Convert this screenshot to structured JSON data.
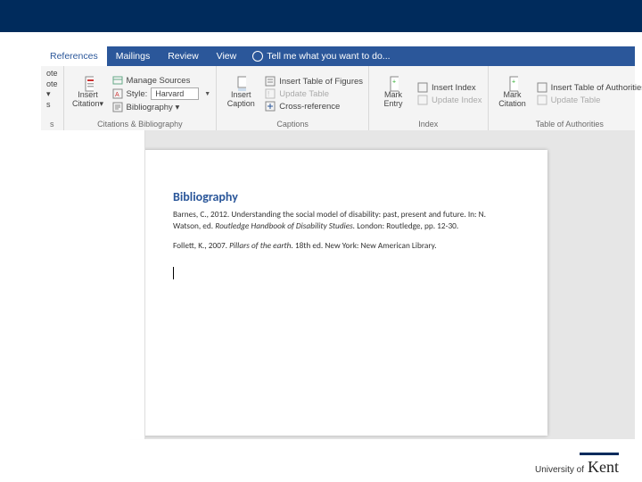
{
  "topbar": {},
  "tabs": {
    "active": "References",
    "items": [
      "References",
      "Mailings",
      "Review",
      "View"
    ],
    "tell_me": "Tell me what you want to do..."
  },
  "ribbon": {
    "frag": {
      "l1": "ote",
      "l2": "ote ▾",
      "l3": "s",
      "group": "s"
    },
    "citations": {
      "big_label": "Insert\nCitation▾",
      "manage": "Manage Sources",
      "style_label": "Style:",
      "style_value": "Harvard",
      "biblio": "Bibliography ▾",
      "group": "Citations & Bibliography"
    },
    "captions": {
      "big_label": "Insert\nCaption",
      "tof": "Insert Table of Figures",
      "update": "Update Table",
      "cross": "Cross-reference",
      "group": "Captions"
    },
    "index": {
      "big_label": "Mark\nEntry",
      "insert": "Insert Index",
      "update": "Update Index",
      "group": "Index"
    },
    "toa": {
      "big_label": "Mark\nCitation",
      "insert": "Insert Table of Authorities",
      "update": "Update Table",
      "group": "Table of Authorities"
    }
  },
  "doc": {
    "heading": "Bibliography",
    "entries": [
      {
        "pre": "Barnes, C., 2012. Understanding the social model of disability: past, present and future. In: N. Watson, ed. ",
        "ital": "Routledge Handbook of Disability Studies.",
        "post": " London: Routledge, pp. 12-30."
      },
      {
        "pre": "Follett, K., 2007. ",
        "ital": "Pillars of the earth.",
        "post": " 18th ed. New York: New American Library."
      }
    ]
  },
  "brand": {
    "uni": "University of",
    "name": "Kent"
  }
}
